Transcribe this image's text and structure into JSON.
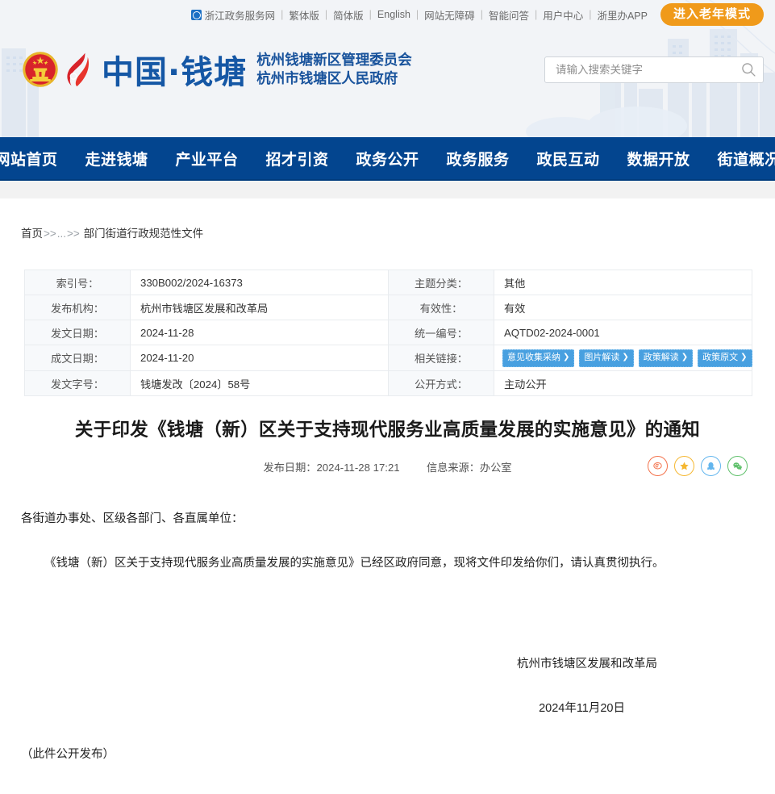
{
  "topbar": {
    "gov_portal": "浙江政务服务网",
    "gov_portal_icon": "zhejiang-gov-icon",
    "links": [
      "繁体版",
      "简体版",
      "English",
      "网站无障碍",
      "智能问答",
      "用户中心",
      "浙里办APP"
    ],
    "elder_mode_button": "进入老年模式",
    "elder_button_color": "#f09a1a"
  },
  "brand": {
    "emblem_icon": "national-emblem-icon",
    "flame_icon": "qiantang-flame-logo-icon",
    "title": "中国·钱塘",
    "subtitle_line1": "杭州钱塘新区管理委员会",
    "subtitle_line2": "杭州市钱塘区人民政府",
    "brand_color": "#1557a5"
  },
  "search": {
    "placeholder": "请输入搜索关键字",
    "value": "",
    "icon": "search-icon"
  },
  "nav": {
    "background": "#03458f",
    "items": [
      "网站首页",
      "走进钱塘",
      "产业平台",
      "招才引资",
      "政务公开",
      "政务服务",
      "政民互动",
      "数据开放",
      "街道概况"
    ]
  },
  "breadcrumb": {
    "home": "首页",
    "arrow": ">>",
    "ellipsis": "...",
    "current": "部门街道行政规范性文件"
  },
  "info_table": {
    "rows": [
      {
        "left_key": "索引号：",
        "left_value": "330B002/2024-16373",
        "right_key": "主题分类：",
        "right_value": "其他"
      },
      {
        "left_key": "发布机构：",
        "left_value": "杭州市钱塘区发展和改革局",
        "right_key": "有效性：",
        "right_value": "有效"
      },
      {
        "left_key": "发文日期：",
        "left_value": "2024-11-28",
        "right_key": "统一编号：",
        "right_value": "AQTD02-2024-0001"
      },
      {
        "left_key": "成文日期：",
        "left_value": "2024-11-20",
        "right_key": "相关链接：",
        "right_value": ""
      },
      {
        "left_key": "发文字号：",
        "left_value": "钱塘发改〔2024〕58号",
        "right_key": "公开方式：",
        "right_value": "主动公开"
      }
    ],
    "related_links": [
      {
        "label": "意见收集采纳",
        "chevron": "❯"
      },
      {
        "label": "图片解读",
        "chevron": "❯"
      },
      {
        "label": "政策解读",
        "chevron": "❯"
      },
      {
        "label": "政策原文",
        "chevron": "❯"
      }
    ],
    "link_button_color": "#48a0e0"
  },
  "document": {
    "title": "关于印发《钱塘（新）区关于支持现代服务业高质量发展的实施意见》的通知",
    "publish_label": "发布日期：",
    "publish_date": "2024-11-28 17:21",
    "source_label": "信息来源：",
    "source": "办公室",
    "shares": [
      {
        "name": "weibo-share-icon",
        "color": "#f3714a"
      },
      {
        "name": "favorite-star-icon",
        "color": "#f5b731"
      },
      {
        "name": "qq-share-icon",
        "color": "#63b6ee"
      },
      {
        "name": "wechat-share-icon",
        "color": "#5fc06b"
      }
    ],
    "salutation": "各街道办事处、区级各部门、各直属单位：",
    "paragraph1": "《钱塘（新）区关于支持现代服务业高质量发展的实施意见》已经区政府同意，现将文件印发给你们，请认真贯彻执行。",
    "signature": "杭州市钱塘区发展和改革局",
    "signature_date": "2024年11月20日",
    "closing_note": "（此件公开发布）"
  }
}
